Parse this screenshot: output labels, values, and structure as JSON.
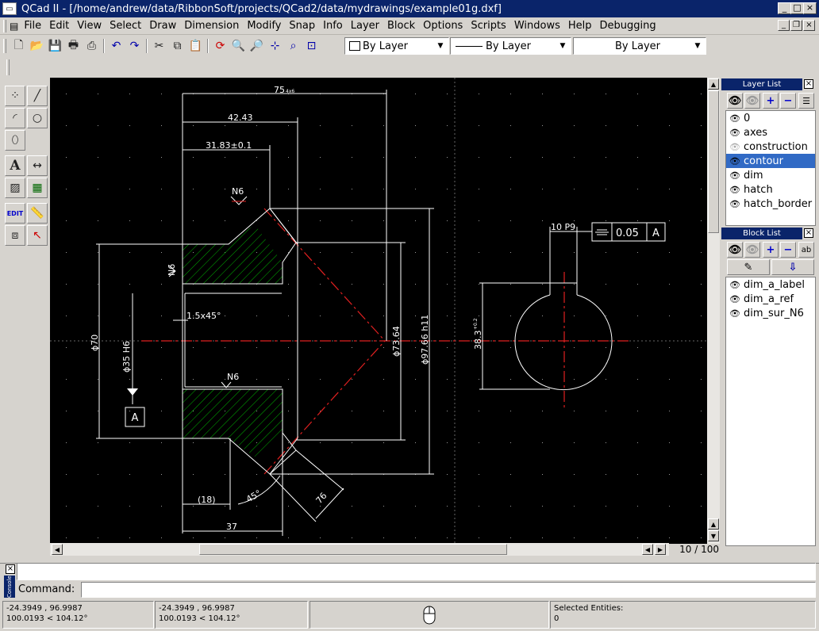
{
  "window": {
    "title": "QCad II - [/home/andrew/data/RibbonSoft/projects/QCad2/data/mydrawings/example01g.dxf]",
    "minimize": "_",
    "maximize": "□",
    "close": "×"
  },
  "menu": [
    "File",
    "Edit",
    "View",
    "Select",
    "Draw",
    "Dimension",
    "Modify",
    "Snap",
    "Info",
    "Layer",
    "Block",
    "Options",
    "Scripts",
    "Windows",
    "Help",
    "Debugging"
  ],
  "toolbar": {
    "color_combo": "By Layer",
    "linetype_combo": "By Layer",
    "width_combo": "By Layer"
  },
  "layer_panel": {
    "title": "Layer List",
    "layers": [
      {
        "name": "0",
        "selected": false
      },
      {
        "name": "axes",
        "selected": false
      },
      {
        "name": "construction",
        "selected": false
      },
      {
        "name": "contour",
        "selected": true
      },
      {
        "name": "dim",
        "selected": false
      },
      {
        "name": "hatch",
        "selected": false
      },
      {
        "name": "hatch_border",
        "selected": false
      }
    ]
  },
  "block_panel": {
    "title": "Block List",
    "blocks": [
      "dim_a_label",
      "dim_a_ref",
      "dim_sur_N6"
    ]
  },
  "scroll": {
    "zoom_label": "10 / 100"
  },
  "command": {
    "label": "Command:",
    "dock_label": "Console"
  },
  "status": {
    "abs_coord": "-24.3949 , 96.9987",
    "abs_polar": "100.0193 < 104.12°",
    "rel_coord": "-24.3949 , 96.9987",
    "rel_polar": "100.0193 < 104.12°",
    "selected_label": "Selected Entities:",
    "selected_count": "0"
  },
  "drawing": {
    "dim_754": "75",
    "dim_754_sup": "4x6",
    "dim_4243": "42.43",
    "dim_3183": "31.83±0.1",
    "n6_top": "N6",
    "n6_left": "N6",
    "n6_mid": "N6",
    "chamfer": "1.5x45°",
    "dia70": "ϕ70",
    "dia35": "ϕ35 H6",
    "datum": "A",
    "dia7364": "ϕ73.64",
    "dia9766": "ϕ97.66 h11",
    "dim18": "(18)",
    "angle45": "45°",
    "dim76": "76",
    "dim37": "37",
    "key_width": "10 P9",
    "tol_value": "0.05",
    "tol_ref": "A",
    "dim383": "38.3",
    "dim383_sup": "+0.2"
  },
  "colors": {
    "titlebar": "#0a246a",
    "canvas": "#000000",
    "hatch": "#00a000",
    "axis": "#ff0000",
    "selected": "#316ac5"
  }
}
